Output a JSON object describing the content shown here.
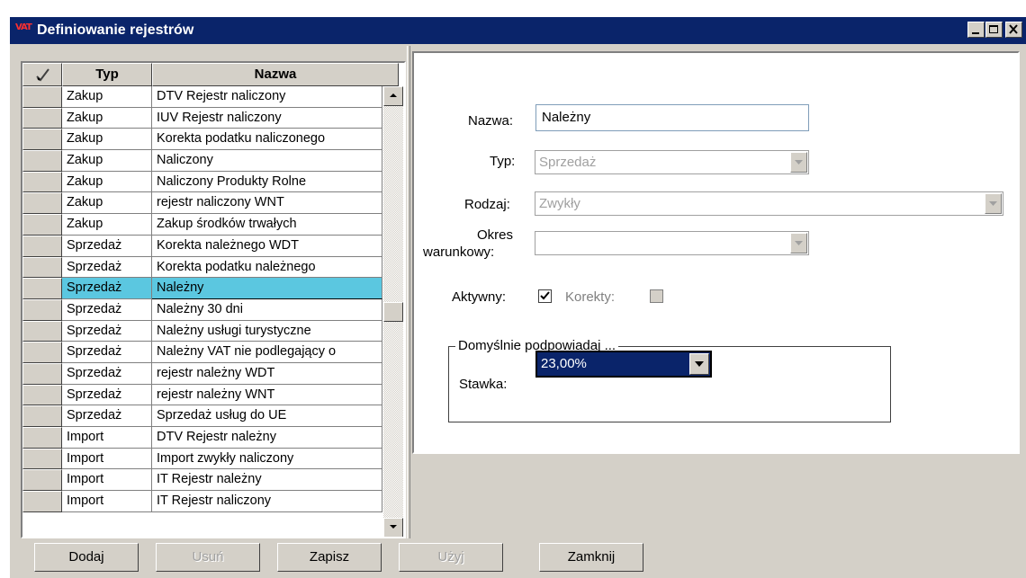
{
  "window": {
    "title": "Definiowanie rejestrów",
    "icon_text": "VAT",
    "icons": {
      "minimize": "minimize-icon",
      "maximize": "maximize-icon",
      "close": "close-icon",
      "app": "vat-app-icon"
    }
  },
  "grid": {
    "headers": {
      "sel": "check-icon",
      "typ": "Typ",
      "nazwa": "Nazwa"
    },
    "rows": [
      {
        "typ": "Zakup",
        "nazwa": "DTV Rejestr naliczony"
      },
      {
        "typ": "Zakup",
        "nazwa": "IUV Rejestr naliczony"
      },
      {
        "typ": "Zakup",
        "nazwa": "Korekta podatku naliczonego"
      },
      {
        "typ": "Zakup",
        "nazwa": "Naliczony"
      },
      {
        "typ": "Zakup",
        "nazwa": "Naliczony Produkty Rolne"
      },
      {
        "typ": "Zakup",
        "nazwa": "rejestr naliczony WNT"
      },
      {
        "typ": "Zakup",
        "nazwa": "Zakup środków trwałych"
      },
      {
        "typ": "Sprzedaż",
        "nazwa": "Korekta należnego WDT"
      },
      {
        "typ": "Sprzedaż",
        "nazwa": "Korekta podatku należnego"
      },
      {
        "typ": "Sprzedaż",
        "nazwa": "Należny"
      },
      {
        "typ": "Sprzedaż",
        "nazwa": "Należny 30 dni"
      },
      {
        "typ": "Sprzedaż",
        "nazwa": "Należny usługi turystyczne"
      },
      {
        "typ": "Sprzedaż",
        "nazwa": "Należny VAT nie podlegający o"
      },
      {
        "typ": "Sprzedaż",
        "nazwa": "rejestr należny WDT"
      },
      {
        "typ": "Sprzedaż",
        "nazwa": "rejestr należny WNT"
      },
      {
        "typ": "Sprzedaż",
        "nazwa": "Sprzedaż usług do UE"
      },
      {
        "typ": "Import",
        "nazwa": "DTV Rejestr należny"
      },
      {
        "typ": "Import",
        "nazwa": "Import zwykły naliczony"
      },
      {
        "typ": "Import",
        "nazwa": "IT Rejestr należny"
      },
      {
        "typ": "Import",
        "nazwa": "IT Rejestr naliczony"
      }
    ],
    "selected_row": "Należny"
  },
  "form": {
    "nazwa_label": "Nazwa:",
    "nazwa_value": "Należny",
    "typ_label": "Typ:",
    "typ_value": "Sprzedaż",
    "rodzaj_label": "Rodzaj:",
    "rodzaj_value": "Zwykły",
    "okres_label_1": "Okres",
    "okres_label_2": "warunkowy:",
    "okres_value": "",
    "aktywny_label": "Aktywny:",
    "aktywny_checked": true,
    "korekty_label": "Korekty:",
    "korekty_checked": false,
    "group_title": "Domyślnie podpowiadaj ...",
    "stawka_label": "Stawka:",
    "stawka_value": "23,00%"
  },
  "buttons": {
    "dodaj": "Dodaj",
    "usun": "Usuń",
    "zapisz": "Zapisz",
    "uzyj": "Użyj",
    "zamknij": "Zamknij"
  },
  "colors": {
    "titlebar": "#0a246a",
    "selected_row": "#5bc7e0",
    "face": "#d4d0c8"
  }
}
